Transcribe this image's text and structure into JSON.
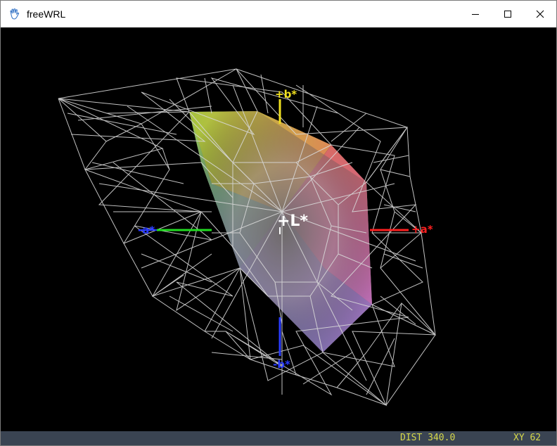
{
  "window": {
    "title": "freeWRL",
    "app_icon": "hand-icon",
    "controls": [
      "minimize-icon",
      "maximize-icon",
      "close-icon"
    ]
  },
  "scene": {
    "axis_labels": {
      "l_star": "+L*",
      "plus_a": "+a*",
      "minus_a": "-a*",
      "plus_b": "+b*",
      "minus_b": "-b*"
    },
    "colors": {
      "background": "#000000",
      "wireframe": "#d8d8d8",
      "plus_a_axis": "#ff2020",
      "minus_a_axis": "#22dd22",
      "plus_b_axis": "#f0e020",
      "minus_b_axis": "#2a3cff",
      "l_axis": "#ffffff"
    }
  },
  "statusbar": {
    "dist": "DIST 340.0",
    "xy": "XY  62"
  }
}
